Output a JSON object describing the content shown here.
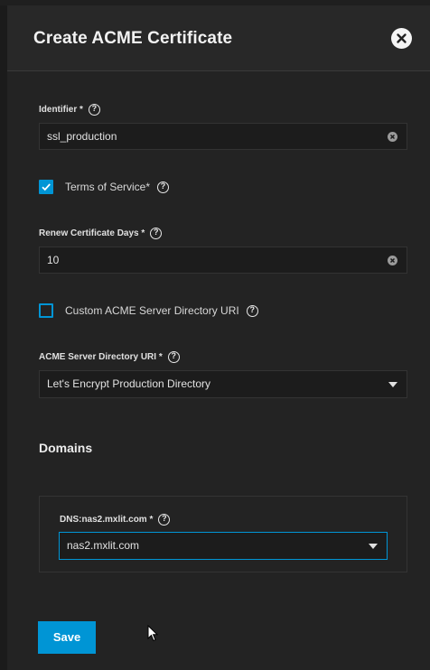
{
  "dialog": {
    "title": "Create ACME Certificate"
  },
  "identifier": {
    "label": "Identifier *",
    "value": "ssl_production"
  },
  "terms": {
    "label": "Terms of Service*",
    "checked": true
  },
  "renew": {
    "label": "Renew Certificate Days *",
    "value": "10"
  },
  "custom_uri": {
    "label": "Custom ACME Server Directory URI",
    "checked": false
  },
  "directory": {
    "label": "ACME Server Directory URI *",
    "selected": "Let's Encrypt Production Directory"
  },
  "domains": {
    "title": "Domains",
    "dns_label": "DNS:nas2.mxlit.com *",
    "dns_selected": "nas2.mxlit.com"
  },
  "actions": {
    "save_label": "Save"
  },
  "colors": {
    "accent": "#0095d5",
    "background": "#232323",
    "input_background": "#1c1c1c"
  }
}
